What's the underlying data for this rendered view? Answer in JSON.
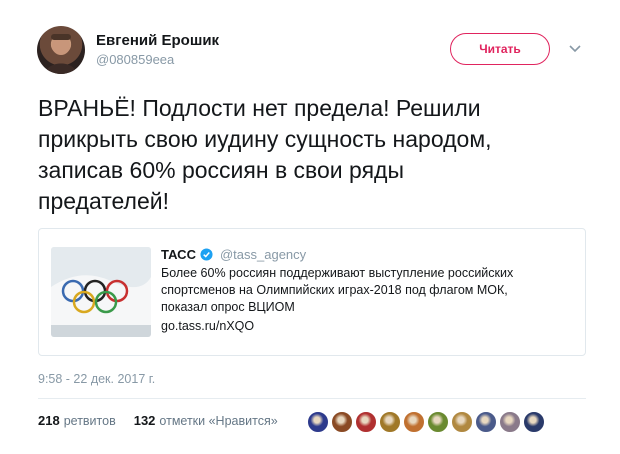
{
  "user": {
    "name": "Евгений Ерошик",
    "handle": "@080859eea"
  },
  "follow_button": {
    "label": "Читать"
  },
  "tweet": {
    "text": "ВРАНЬЁ! Подлости нет предела! Решили\nприкрыть свою иудину сущность народом,\nзаписав 60% россиян в свои ряды\nпредателей!",
    "timestamp": "9:58 - 22 дек. 2017 г."
  },
  "quote": {
    "author": "ТАСС",
    "handle": "@tass_agency",
    "text": "Более 60% россиян поддерживают выступление российских\nспортсменов на Олимпийских играх-2018 под флагом МОК,\nпоказал опрос ВЦИОМ",
    "link": "go.tass.ru/nXQO"
  },
  "stats": {
    "retweets_count": "218",
    "retweets_label": "ретвитов",
    "likes_count": "132",
    "likes_label": "отметки «Нравится»"
  },
  "colors": {
    "accent": "#e0245e",
    "verified": "#1da1f2",
    "muted": "#8899a6"
  },
  "likers": [
    {
      "name": "liker-avatar-1",
      "color": "#2d3a8c"
    },
    {
      "name": "liker-avatar-2",
      "color": "#8a4a24"
    },
    {
      "name": "liker-avatar-3",
      "color": "#b03030"
    },
    {
      "name": "liker-avatar-4",
      "color": "#a07828"
    },
    {
      "name": "liker-avatar-5",
      "color": "#c07030"
    },
    {
      "name": "liker-avatar-6",
      "color": "#6a8a30"
    },
    {
      "name": "liker-avatar-7",
      "color": "#b08840"
    },
    {
      "name": "liker-avatar-8",
      "color": "#4a5a8a"
    },
    {
      "name": "liker-avatar-9",
      "color": "#8a7a8a"
    },
    {
      "name": "liker-avatar-10",
      "color": "#2a3a6a"
    }
  ]
}
